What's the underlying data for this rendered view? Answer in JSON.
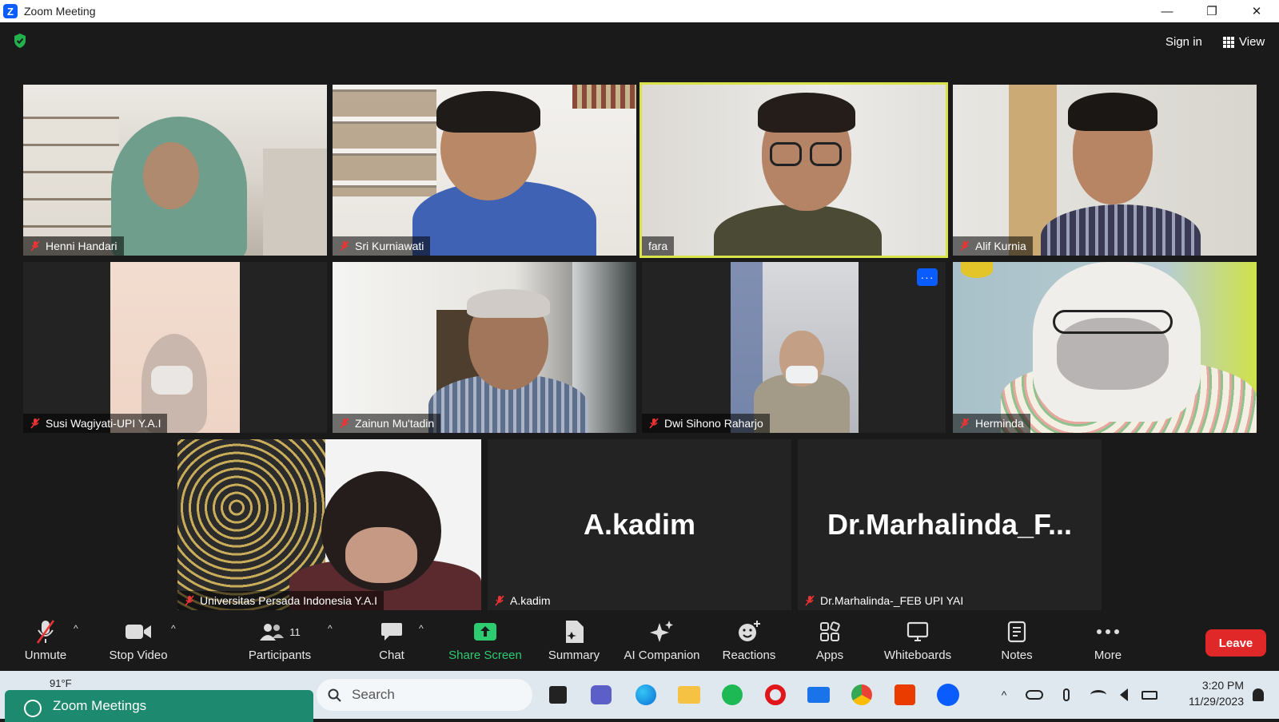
{
  "window": {
    "title": "Zoom Meeting",
    "minimize": "—",
    "restore": "❐",
    "close": "✕"
  },
  "header": {
    "sign_in": "Sign in",
    "view": "View"
  },
  "tiles": [
    {
      "name": "Henni Handari"
    },
    {
      "name": "Sri Kurniawati"
    },
    {
      "name": "fara"
    },
    {
      "name": "Alif Kurnia"
    },
    {
      "name": "Susi Wagiyati-UPI Y.A.I"
    },
    {
      "name": "Zainun Mu'tadin"
    },
    {
      "name": "Dwi Sihono Raharjo"
    },
    {
      "name": "Herminda"
    },
    {
      "name": "Universitas Persada Indonesia Y.A.I"
    },
    {
      "name": "A.kadim",
      "big": "A.kadim"
    },
    {
      "name": "Dr.Marhalinda-_FEB UPI YAI",
      "big": "Dr.Marhalinda_F..."
    }
  ],
  "more_button": "···",
  "toolbar": {
    "unmute": "Unmute",
    "stop_video": "Stop Video",
    "participants": "Participants",
    "participants_count": "11",
    "chat": "Chat",
    "share_screen": "Share Screen",
    "summary": "Summary",
    "ai_companion": "AI Companion",
    "reactions": "Reactions",
    "apps": "Apps",
    "whiteboards": "Whiteboards",
    "notes": "Notes",
    "more": "More",
    "leave": "Leave"
  },
  "taskbar": {
    "weather": "91°F",
    "toast": "Zoom Meetings",
    "search_placeholder": "Search",
    "time": "3:20 PM",
    "date": "11/29/2023"
  },
  "colors": {
    "active_speaker": "#d8e24a",
    "leave": "#e02828",
    "share": "#2ecc71",
    "zoom_blue": "#0b5cff"
  }
}
